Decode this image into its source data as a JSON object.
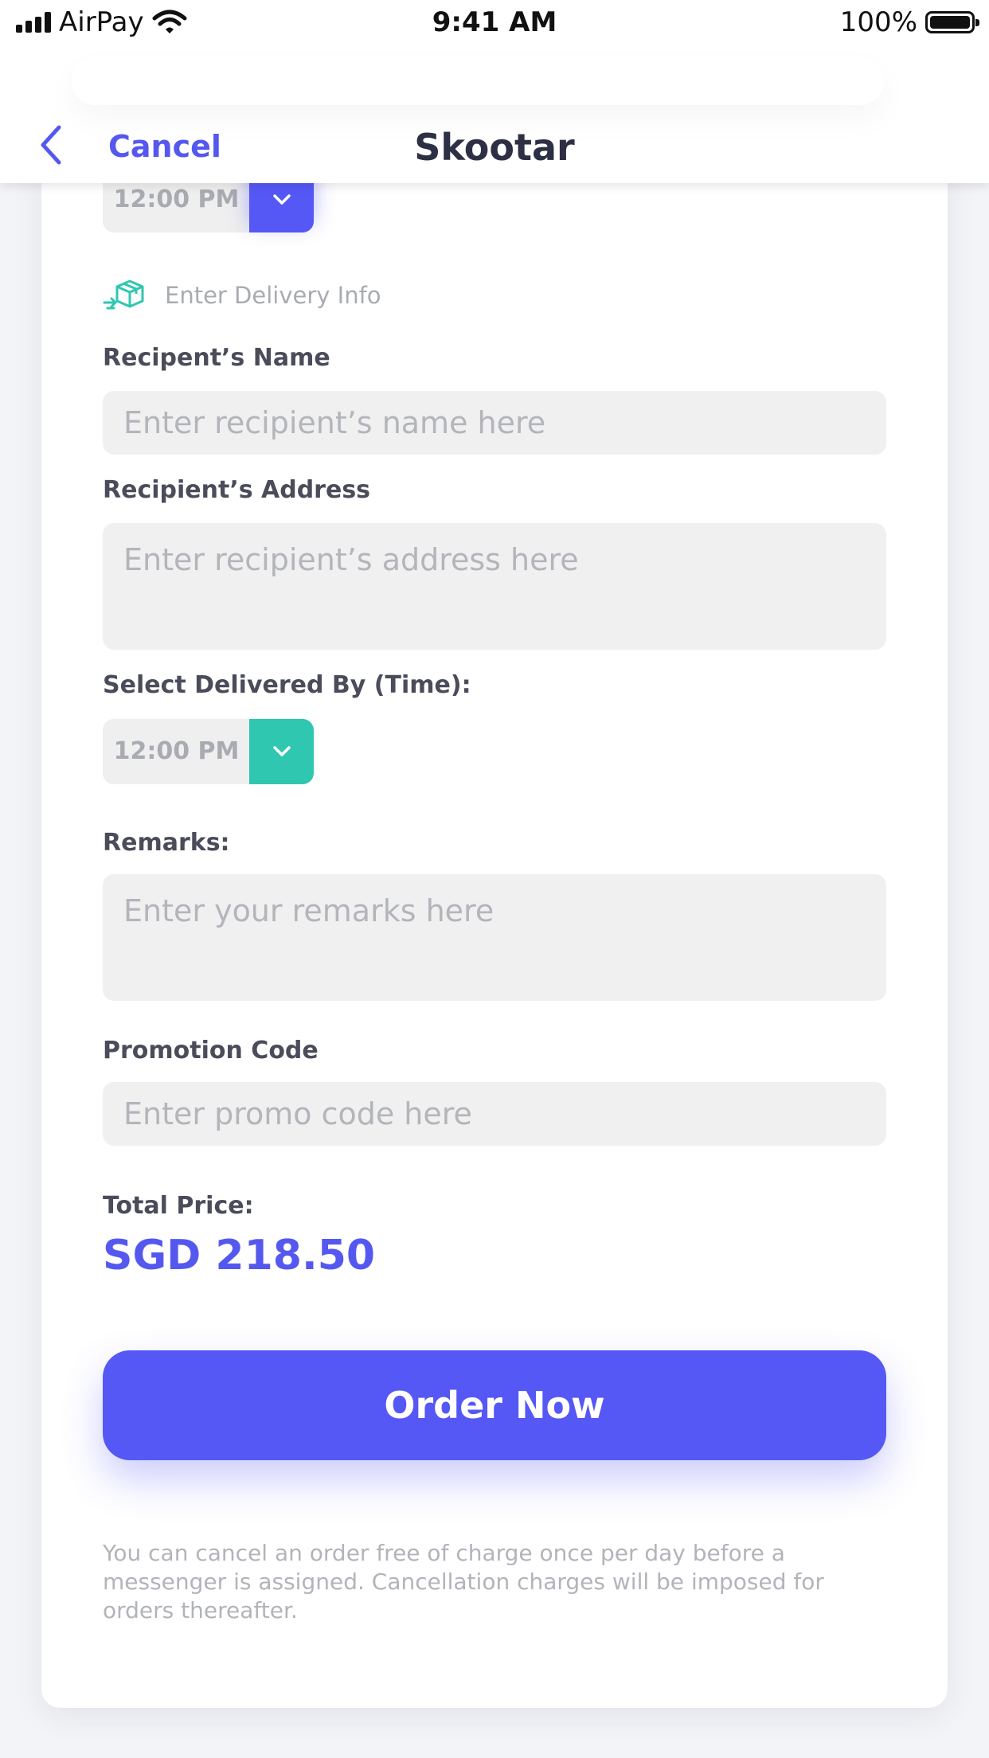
{
  "status_bar": {
    "carrier": "AirPay",
    "time": "9:41 AM",
    "battery": "100%"
  },
  "nav": {
    "cancel_label": "Cancel",
    "title": "Skootar"
  },
  "pickup": {
    "time_value": "12:00 PM"
  },
  "section": {
    "title": "Enter Delivery Info"
  },
  "recipient_name": {
    "label": "Recipent’s Name",
    "placeholder": "Enter recipient’s name here",
    "value": ""
  },
  "recipient_address": {
    "label": "Recipient’s Address",
    "placeholder": "Enter recipient’s address here",
    "value": ""
  },
  "delivered_by": {
    "label": "Select Delivered By (Time):",
    "time_value": "12:00 PM"
  },
  "remarks": {
    "label": "Remarks:",
    "placeholder": "Enter your remarks here",
    "value": ""
  },
  "promo": {
    "label": "Promotion Code",
    "placeholder": "Enter promo code here",
    "value": ""
  },
  "total": {
    "label": "Total Price:",
    "value": "SGD 218.50"
  },
  "order_button": {
    "label": "Order Now"
  },
  "disclaimer": "You can cancel an order free of charge once per day before a messenger is assigned. Cancellation charges will be imposed for orders thereafter.",
  "colors": {
    "primary": "#5558f5",
    "teal": "#2fc7b0",
    "text_dark": "#2d2f44",
    "placeholder": "#b3b5bb"
  },
  "icons": [
    "signal-icon",
    "wifi-icon",
    "battery-icon",
    "back-chevron-icon",
    "chevron-down-icon",
    "delivery-box-icon"
  ]
}
